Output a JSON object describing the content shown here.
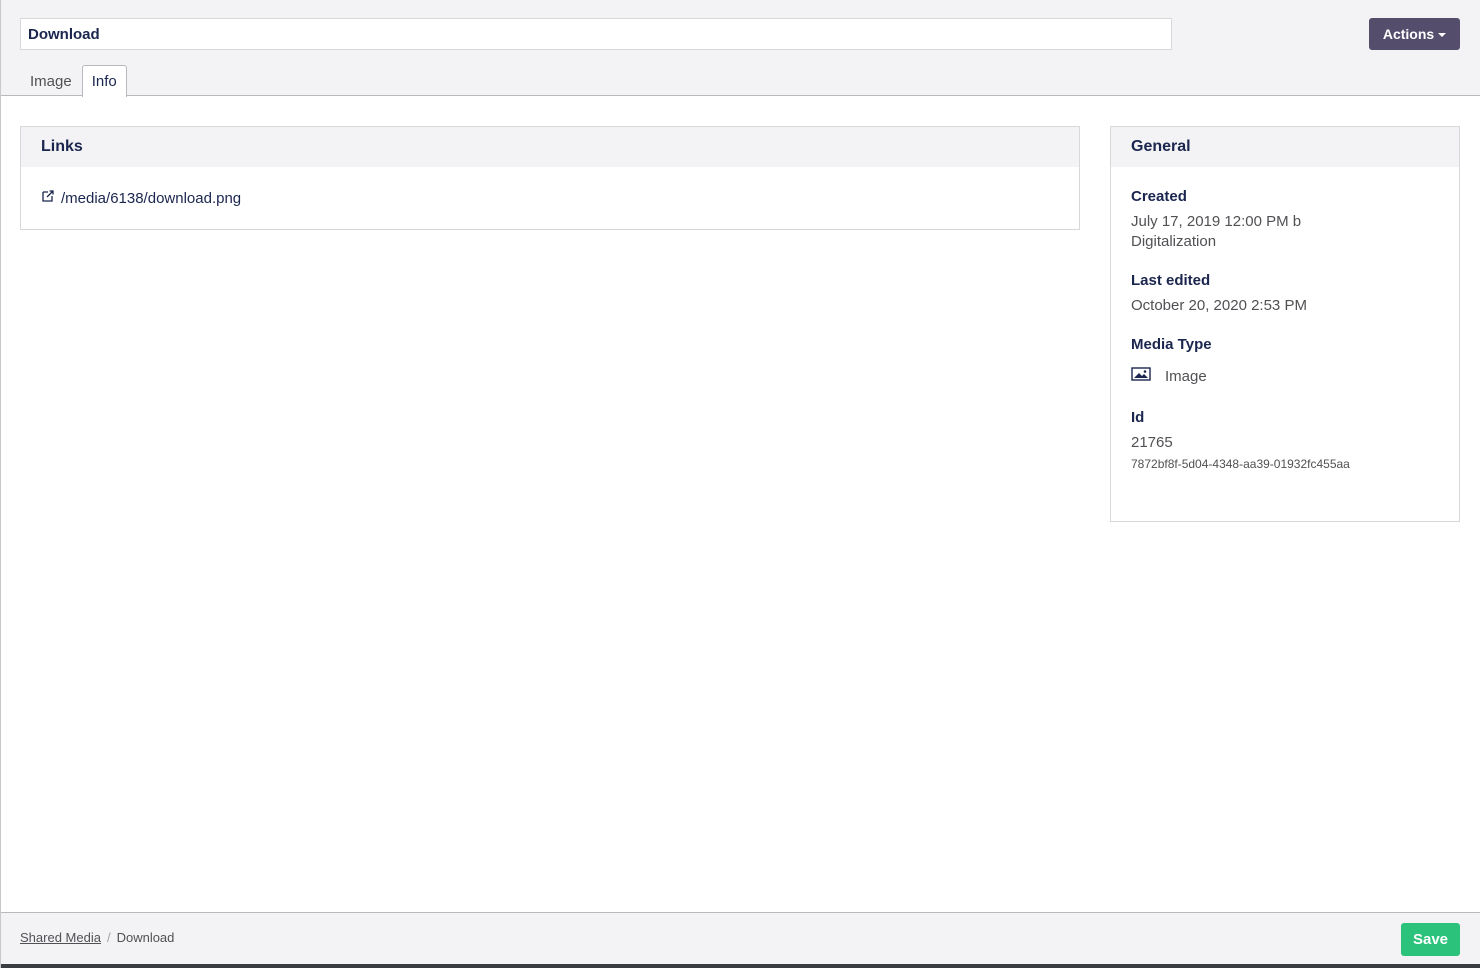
{
  "header": {
    "name_value": "Download",
    "actions_label": "Actions",
    "tabs": [
      {
        "label": "Image",
        "active": false
      },
      {
        "label": "Info",
        "active": true
      }
    ]
  },
  "links": {
    "title": "Links",
    "items": [
      {
        "icon": "external-link-icon",
        "text": "/media/6138/download.png"
      }
    ]
  },
  "general": {
    "title": "General",
    "created_label": "Created",
    "created_value": "July 17, 2019 12:00 PM b",
    "created_by": "Digitalization",
    "last_edited_label": "Last edited",
    "last_edited_value": "October 20, 2020 2:53 PM",
    "media_type_label": "Media Type",
    "media_type_icon": "picture-icon",
    "media_type_value": "Image",
    "id_label": "Id",
    "id_value": "21765",
    "guid_value": "7872bf8f-5d04-4348-aa39-01932fc455aa"
  },
  "footer": {
    "breadcrumb": [
      {
        "label": "Shared Media",
        "link": true
      },
      {
        "label": "Download",
        "link": false
      }
    ],
    "separator": "/",
    "save_label": "Save"
  },
  "colors": {
    "actions_bg": "#544e6c",
    "save_bg": "#2bc37c",
    "header_bg": "#f3f3f5",
    "text_primary": "#1b264f"
  }
}
